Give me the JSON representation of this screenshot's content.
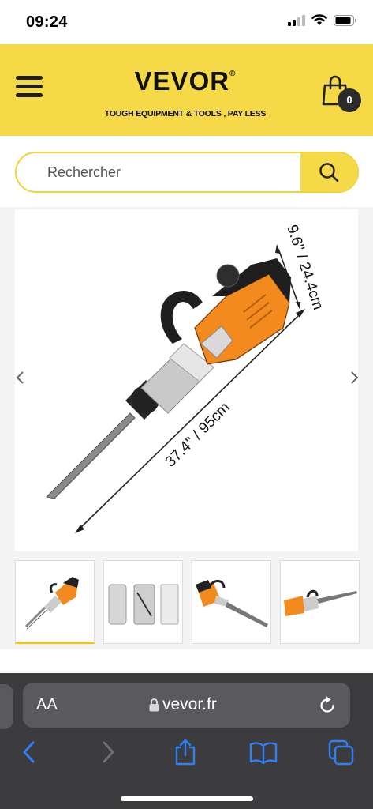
{
  "status_bar": {
    "time": "09:24"
  },
  "header": {
    "brand": "VEVOR",
    "brand_mark": "®",
    "tagline": "TOUGH EQUIPMENT & TOOLS , PAY LESS",
    "cart_count": "0",
    "colors": {
      "background": "#f5d946",
      "dark": "#2b2b2b"
    }
  },
  "search": {
    "placeholder": "Rechercher"
  },
  "product_image": {
    "dimension_height": "9.6'' / 24.4cm",
    "dimension_length": "37.4'' / 95cm"
  },
  "thumbnails": [
    {
      "label": "dimensions view",
      "active": true
    },
    {
      "label": "accessories",
      "active": false
    },
    {
      "label": "side view",
      "active": false
    },
    {
      "label": "angle view",
      "active": false
    }
  ],
  "browser": {
    "text_size_button": "AA",
    "url": "vevor.fr"
  }
}
